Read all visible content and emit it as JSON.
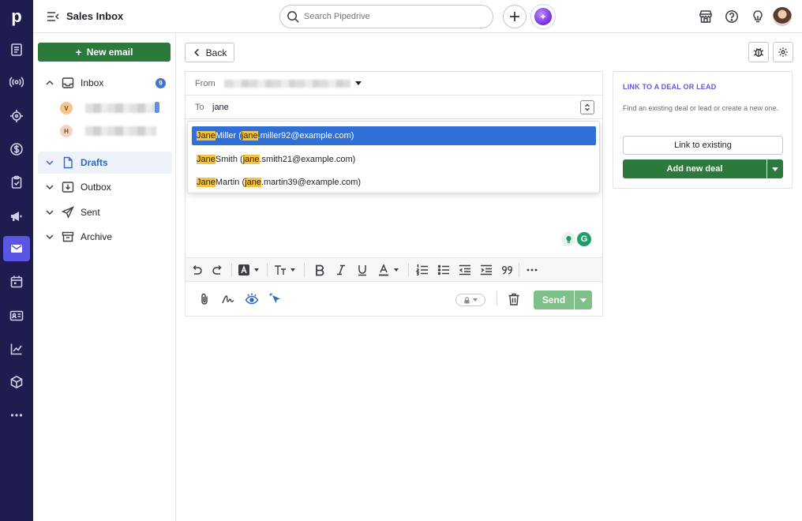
{
  "app": {
    "title": "Sales Inbox",
    "logo": "p"
  },
  "search": {
    "placeholder": "Search Pipedrive"
  },
  "sidebar": {
    "new_email_label": "New email",
    "inbox_label": "Inbox",
    "inbox_badge": "9",
    "accounts": [
      {
        "initial": "V",
        "color": "#f6c48c"
      },
      {
        "initial": "H",
        "color": "#f1d4c4"
      }
    ],
    "folders": [
      {
        "label": "Drafts",
        "active": true
      },
      {
        "label": "Outbox",
        "active": false
      },
      {
        "label": "Sent",
        "active": false
      },
      {
        "label": "Archive",
        "active": false
      }
    ]
  },
  "compose": {
    "back_label": "Back",
    "from_label": "From",
    "to_label": "To",
    "to_value": "jane",
    "send_label": "Send"
  },
  "suggestions": [
    {
      "hl1": "Jane",
      "rest1": " Miller (",
      "hl2": "jane",
      "rest2": ".miller92@example.com)",
      "selected": true
    },
    {
      "hl1": "Jane",
      "rest1": " Smith (",
      "hl2": "jane",
      "rest2": ".smith21@example.com)",
      "selected": false
    },
    {
      "hl1": "Jane",
      "rest1": " Martin (",
      "hl2": "jane",
      "rest2": ".martin39@example.com)",
      "selected": false
    }
  ],
  "link_panel": {
    "title": "LINK TO A DEAL OR LEAD",
    "description": "Find an existing deal or lead or create a new one.",
    "link_existing_label": "Link to existing",
    "add_deal_label": "Add new deal"
  },
  "colors": {
    "rail": "#1f1c4f",
    "rail_active": "#5b55e6",
    "primary_green": "#2c7a3b",
    "selection_blue": "#2f6fd6",
    "highlight_yellow": "#f5c342",
    "panel_title_purple": "#6f52d8"
  }
}
